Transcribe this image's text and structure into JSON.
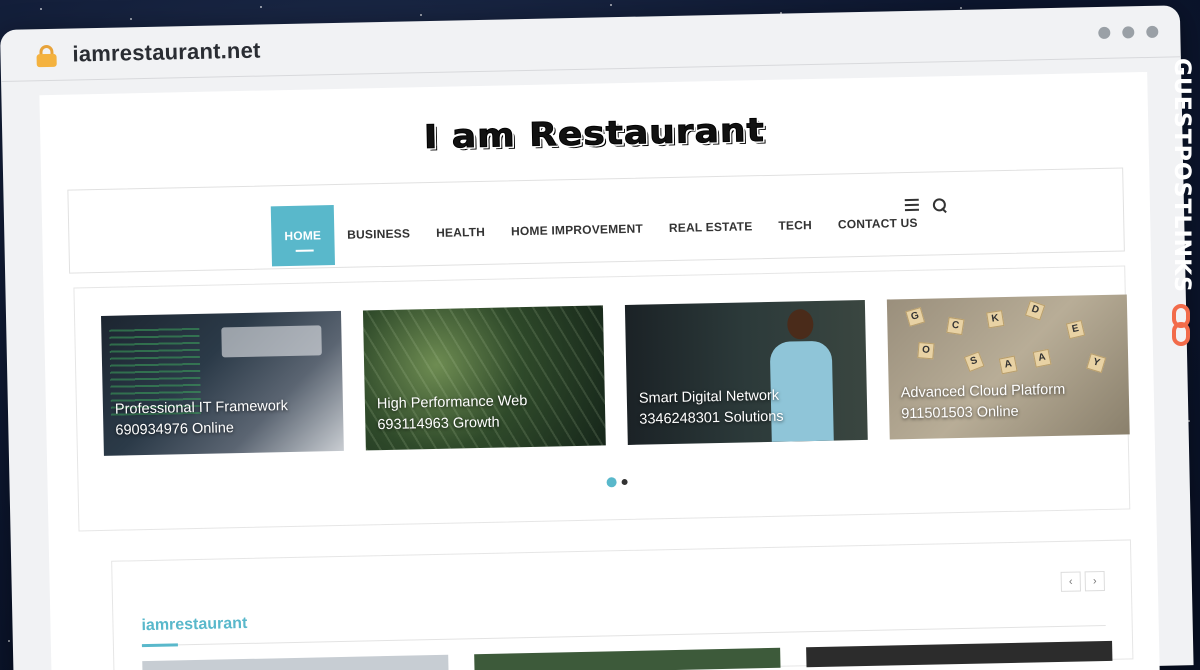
{
  "browser": {
    "url": "iamrestaurant.net"
  },
  "site": {
    "logo_text": "I am Restaurant"
  },
  "nav": {
    "items": [
      {
        "label": "HOME",
        "active": true
      },
      {
        "label": "BUSINESS"
      },
      {
        "label": "HEALTH"
      },
      {
        "label": "HOME IMPROVEMENT"
      },
      {
        "label": "REAL ESTATE"
      },
      {
        "label": "TECH"
      },
      {
        "label": "CONTACT US"
      }
    ],
    "icons": [
      "menu-icon",
      "search-icon"
    ]
  },
  "slider": {
    "cards": [
      {
        "line1": "Professional IT Framework",
        "line2": "690934976 Online"
      },
      {
        "line1": "High Performance Web",
        "line2": "693114963 Growth"
      },
      {
        "line1": "Smart Digital Network",
        "line2": "3346248301 Solutions"
      },
      {
        "line1": "Advanced Cloud Platform",
        "line2": "911501503 Online"
      }
    ],
    "pages": 2,
    "active_page": 1
  },
  "section": {
    "title": "iamrestaurant",
    "prev_icon": "chevron-left-icon",
    "next_icon": "chevron-right-icon"
  },
  "watermark": {
    "brand": "GUESTPOSTLINKS"
  }
}
